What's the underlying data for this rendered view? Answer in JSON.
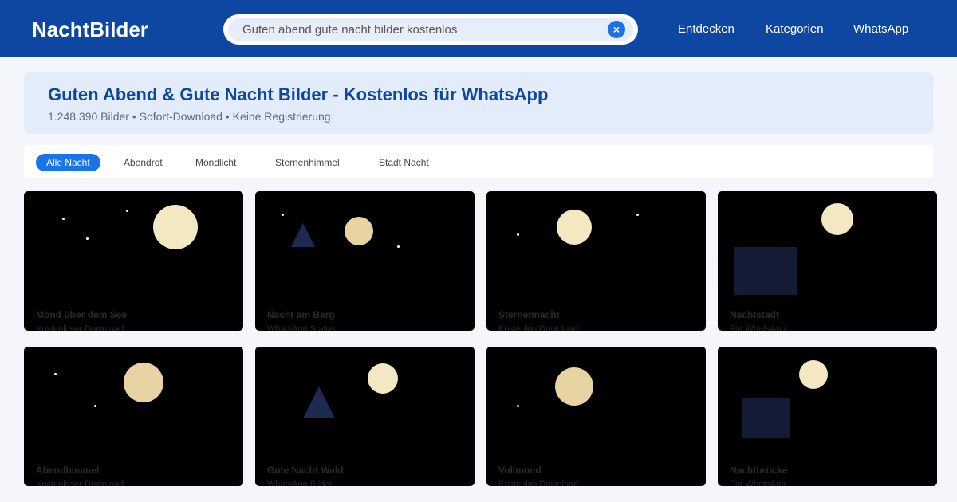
{
  "header": {
    "logo": "NachtBilder",
    "search": {
      "value": "Guten abend gute nacht bilder kostenlos",
      "clear_icon": "close-icon"
    },
    "nav": [
      "Entdecken",
      "Kategorien",
      "WhatsApp"
    ]
  },
  "hero": {
    "title": "Guten Abend & Gute Nacht Bilder - Kostenlos für WhatsApp",
    "subtitle": "1.248.390 Bilder • Sofort-Download • Keine Registrierung"
  },
  "filters": {
    "items": [
      "Alle Nacht",
      "Abendrot",
      "Mondlicht",
      "Sternenhimmel",
      "Stadt Nacht"
    ],
    "active": "Alle Nacht"
  },
  "colors": {
    "header": "#0d47a1",
    "accent": "#1a73e8",
    "moon_light": "#f4e8c3",
    "moon_warm": "#e8d4a2",
    "shape_navy": "#141c35"
  },
  "cards": [
    {
      "title": "Mond über dem See",
      "subtitle": "Kostenloser Download"
    },
    {
      "title": "Nacht am Berg",
      "subtitle": "WhatsApp Status"
    },
    {
      "title": "Sternennacht",
      "subtitle": "Kostenlos Download"
    },
    {
      "title": "Nachtstadt",
      "subtitle": "Für WhatsApp"
    },
    {
      "title": "Abendhimmel",
      "subtitle": "Kostenloser Download"
    },
    {
      "title": "Gute Nacht Wald",
      "subtitle": "WhatsApp Bilder"
    },
    {
      "title": "Vollmond",
      "subtitle": "Kostenlos Download"
    },
    {
      "title": "Nachtbrücke",
      "subtitle": "Für WhatsApp"
    }
  ]
}
